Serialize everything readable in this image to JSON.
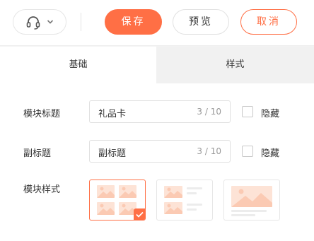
{
  "toolbar": {
    "support_icon": "headset-icon",
    "dropdown_icon": "chevron-down-icon",
    "save_label": "保存",
    "preview_label": "预览",
    "cancel_label": "取消",
    "accent_color": "#ff6f45"
  },
  "tabs": [
    {
      "label": "基础",
      "active": true
    },
    {
      "label": "样式",
      "active": false
    }
  ],
  "form": {
    "title": {
      "label": "模块标题",
      "value": "礼品卡",
      "count": "3 / 10",
      "hide_label": "隐藏",
      "hidden": false
    },
    "subtitle": {
      "label": "副标题",
      "value": "副标题",
      "count": "3 / 10",
      "hide_label": "隐藏",
      "hidden": false
    },
    "module_style": {
      "label": "模块样式",
      "options": [
        {
          "icon": "grid-2x2-layout-icon",
          "selected": true
        },
        {
          "icon": "list-layout-icon",
          "selected": false
        },
        {
          "icon": "banner-layout-icon",
          "selected": false
        }
      ]
    }
  }
}
